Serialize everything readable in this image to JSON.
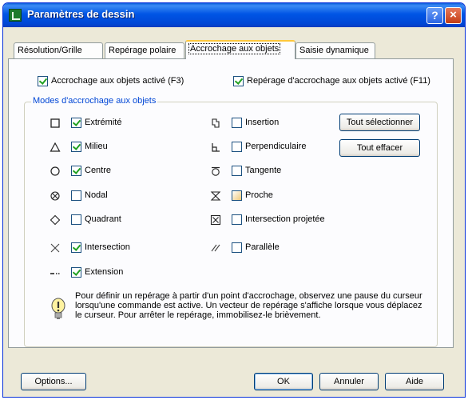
{
  "window": {
    "title": "Paramètres de dessin",
    "help_label": "?",
    "close_label": "×"
  },
  "tabs": [
    {
      "label": "Résolution/Grille"
    },
    {
      "label": "Repérage polaire"
    },
    {
      "label": "Accrochage aux objets",
      "active": true
    },
    {
      "label": "Saisie dynamique"
    }
  ],
  "top_options": {
    "snap_enabled": {
      "label": "Accrochage aux objets activé (F3)",
      "checked": true
    },
    "tracking_enabled": {
      "label": "Repérage d'accrochage aux objets activé (F11)",
      "checked": true
    }
  },
  "modes_group": {
    "title": "Modes d'accrochage aux objets",
    "left": [
      {
        "label": "Extrémité",
        "checked": true,
        "symbol": "square-icon"
      },
      {
        "label": "Milieu",
        "checked": true,
        "symbol": "triangle-icon"
      },
      {
        "label": "Centre",
        "checked": true,
        "symbol": "circle-icon"
      },
      {
        "label": "Nodal",
        "checked": false,
        "symbol": "node-icon"
      },
      {
        "label": "Quadrant",
        "checked": false,
        "symbol": "diamond-icon"
      },
      {
        "label": "Intersection",
        "checked": true,
        "symbol": "x-cross-icon"
      },
      {
        "label": "Extension",
        "checked": true,
        "symbol": "dashed-line-icon"
      }
    ],
    "right": [
      {
        "label": "Insertion",
        "checked": false,
        "symbol": "insertion-icon"
      },
      {
        "label": "Perpendiculaire",
        "checked": false,
        "symbol": "perpendicular-icon"
      },
      {
        "label": "Tangente",
        "checked": false,
        "symbol": "tangent-icon"
      },
      {
        "label": "Proche",
        "checked": false,
        "symbol": "hourglass-icon"
      },
      {
        "label": "Intersection projetée",
        "checked": false,
        "symbol": "boxed-x-icon"
      },
      {
        "label": "Parallèle",
        "checked": false,
        "symbol": "parallel-icon"
      }
    ],
    "select_all_label": "Tout sélectionner",
    "clear_all_label": "Tout effacer"
  },
  "info": {
    "icon": "lightbulb-icon",
    "text": "Pour définir un repérage à partir d'un point d'accrochage, observez une pause du curseur lorsqu'une commande est active. Un vecteur de repérage s'affiche lorsque vous déplacez le curseur. Pour arrêter le repérage, immobilisez-le brièvement."
  },
  "footer": {
    "options_label": "Options...",
    "ok_label": "OK",
    "cancel_label": "Annuler",
    "help_label": "Aide"
  }
}
